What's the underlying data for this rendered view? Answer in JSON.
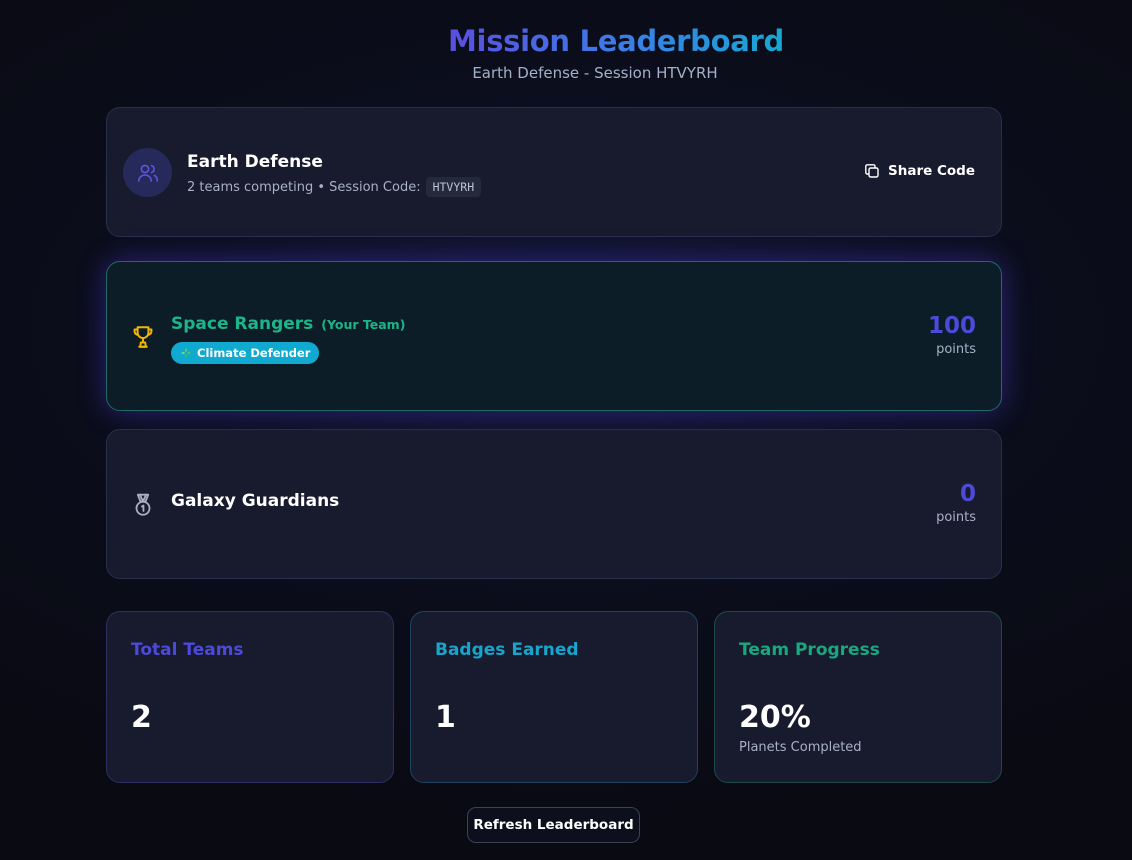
{
  "header": {
    "title": "Mission Leaderboard",
    "subtitle": "Earth Defense - Session HTVYRH"
  },
  "session": {
    "name": "Earth Defense",
    "meta_text": "2 teams competing • Session Code:",
    "code": "HTVYRH",
    "share_label": "Share Code",
    "icons": {
      "avatar": "users-icon",
      "share": "copy-icon"
    }
  },
  "teams": [
    {
      "name": "Space Rangers",
      "tag": "(Your Team)",
      "badge": "Climate Defender",
      "badge_icon": "leaf-icon",
      "points": "100",
      "points_label": "points",
      "rank_icon": "trophy-icon"
    },
    {
      "name": "Galaxy Guardians",
      "points": "0",
      "points_label": "points",
      "rank_icon": "medal-icon"
    }
  ],
  "stats": [
    {
      "label": "Total Teams",
      "value": "2"
    },
    {
      "label": "Badges Earned",
      "value": "1"
    },
    {
      "label": "Team Progress",
      "value": "20%",
      "sub": "Planets Completed"
    }
  ],
  "refresh_label": "Refresh Leaderboard",
  "colors": {
    "indigo": "#4c4ad8",
    "cyan": "#17a5cc",
    "green": "#1cb58a",
    "gold": "#f2b705",
    "background": "#0b0d1b",
    "card": "#181a2e"
  }
}
